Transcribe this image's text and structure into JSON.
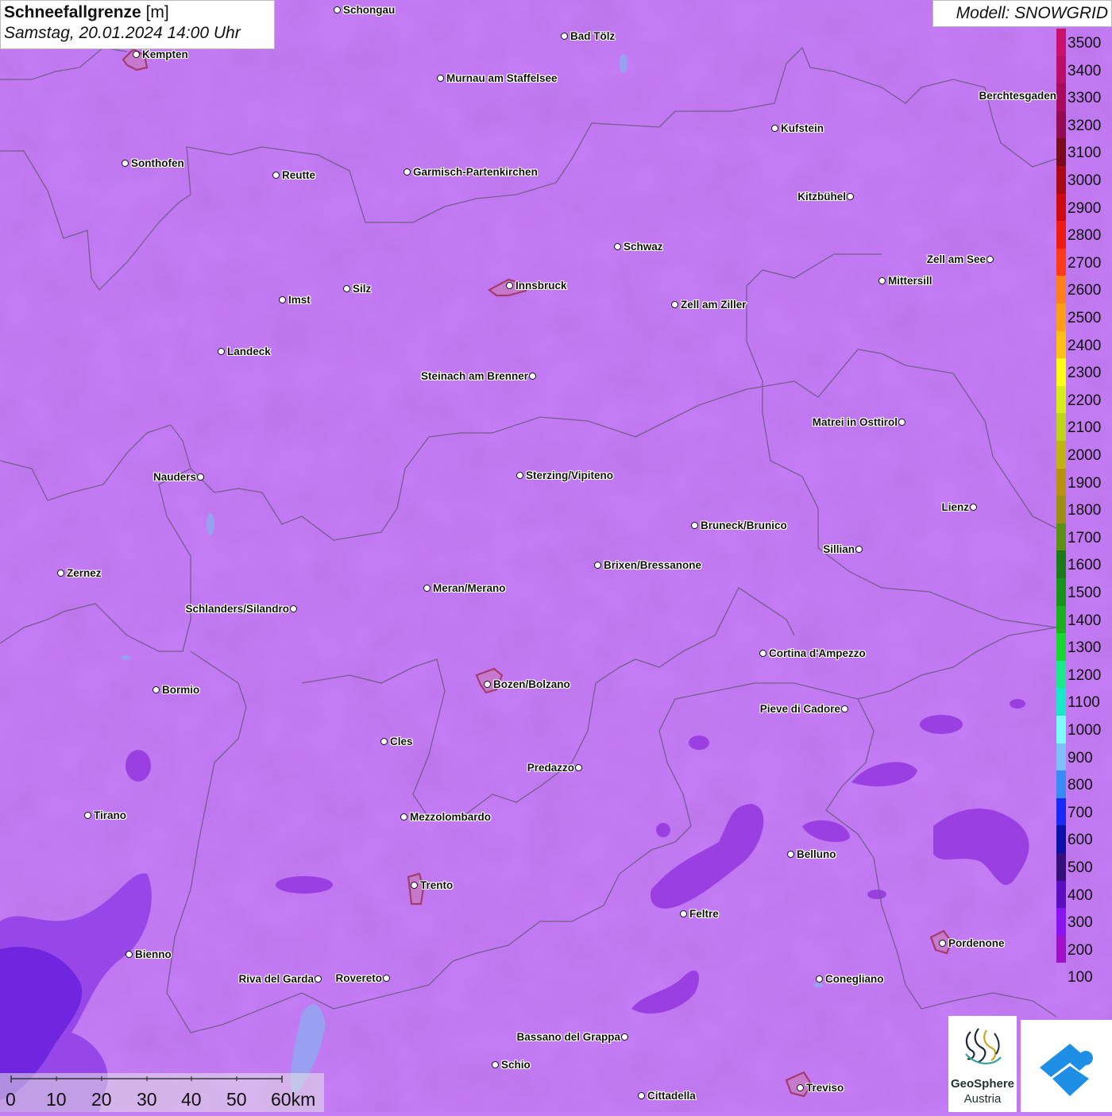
{
  "title": {
    "main": "Schneefallgrenze",
    "unit": "[m]",
    "datetime": "Samstag, 20.01.2024 14:00 Uhr"
  },
  "model": "Modell: SNOWGRID",
  "legend": {
    "items": [
      {
        "label": "3500",
        "color": "#c8116f"
      },
      {
        "label": "3400",
        "color": "#b80d68"
      },
      {
        "label": "3300",
        "color": "#a80a60"
      },
      {
        "label": "3200",
        "color": "#930a55"
      },
      {
        "label": "3100",
        "color": "#7a0a1c"
      },
      {
        "label": "3000",
        "color": "#a90a16"
      },
      {
        "label": "2900",
        "color": "#cc0b12"
      },
      {
        "label": "2800",
        "color": "#ee1b14"
      },
      {
        "label": "2700",
        "color": "#ff3a1a"
      },
      {
        "label": "2600",
        "color": "#ff7f1a"
      },
      {
        "label": "2500",
        "color": "#ff9d17"
      },
      {
        "label": "2400",
        "color": "#ffbf17"
      },
      {
        "label": "2300",
        "color": "#ffff17"
      },
      {
        "label": "2200",
        "color": "#d4ee1c"
      },
      {
        "label": "2100",
        "color": "#bcd51c"
      },
      {
        "label": "2000",
        "color": "#c1b312"
      },
      {
        "label": "1900",
        "color": "#b8920e"
      },
      {
        "label": "1800",
        "color": "#999014"
      },
      {
        "label": "1700",
        "color": "#5a9016"
      },
      {
        "label": "1600",
        "color": "#1a7a1a"
      },
      {
        "label": "1500",
        "color": "#16941a"
      },
      {
        "label": "1400",
        "color": "#1ab01e"
      },
      {
        "label": "1300",
        "color": "#1ad832"
      },
      {
        "label": "1200",
        "color": "#1be98c"
      },
      {
        "label": "1100",
        "color": "#16e8c8"
      },
      {
        "label": "1000",
        "color": "#7efcfc"
      },
      {
        "label": "900",
        "color": "#7ec0f5"
      },
      {
        "label": "800",
        "color": "#3a8af5"
      },
      {
        "label": "700",
        "color": "#1a28f5"
      },
      {
        "label": "600",
        "color": "#0a10a8"
      },
      {
        "label": "500",
        "color": "#35107a"
      },
      {
        "label": "400",
        "color": "#5a0ec0"
      },
      {
        "label": "300",
        "color": "#8a14f0"
      },
      {
        "label": "200",
        "color": "#a010c8"
      },
      {
        "label": "100",
        "color": "#c47cf5"
      }
    ]
  },
  "cities": [
    {
      "name": "Schongau",
      "dot": "left"
    },
    {
      "name": "Bad Tölz",
      "dot": "left"
    },
    {
      "name": "Kempten",
      "dot": "left"
    },
    {
      "name": "Murnau am Staffelsee",
      "dot": "left"
    },
    {
      "name": "Berchtesgaden",
      "dot": "none"
    },
    {
      "name": "Kufstein",
      "dot": "left"
    },
    {
      "name": "Sonthofen",
      "dot": "left"
    },
    {
      "name": "Reutte",
      "dot": "left"
    },
    {
      "name": "Garmisch-Partenkirchen",
      "dot": "left"
    },
    {
      "name": "Kitzbühel",
      "dot": "right"
    },
    {
      "name": "Schwaz",
      "dot": "left"
    },
    {
      "name": "Zell am See",
      "dot": "right"
    },
    {
      "name": "Mittersill",
      "dot": "left"
    },
    {
      "name": "Innsbruck",
      "dot": "left"
    },
    {
      "name": "Imst",
      "dot": "left"
    },
    {
      "name": "Silz",
      "dot": "left"
    },
    {
      "name": "Zell am Ziller",
      "dot": "left"
    },
    {
      "name": "Landeck",
      "dot": "left"
    },
    {
      "name": "Steinach am Brenner",
      "dot": "right"
    },
    {
      "name": "Matrei in Osttirol",
      "dot": "right"
    },
    {
      "name": "Nauders",
      "dot": "right"
    },
    {
      "name": "Sterzing/Vipiteno",
      "dot": "left"
    },
    {
      "name": "Lienz",
      "dot": "right"
    },
    {
      "name": "Bruneck/Brunico",
      "dot": "left"
    },
    {
      "name": "Sillian",
      "dot": "right"
    },
    {
      "name": "Zernez",
      "dot": "left"
    },
    {
      "name": "Brixen/Bressanone",
      "dot": "left"
    },
    {
      "name": "Meran/Merano",
      "dot": "left"
    },
    {
      "name": "Schlanders/Silandro",
      "dot": "right"
    },
    {
      "name": "Cortina d'Ampezzo",
      "dot": "left"
    },
    {
      "name": "Bozen/Bolzano",
      "dot": "left"
    },
    {
      "name": "Bormio",
      "dot": "left"
    },
    {
      "name": "Pieve di Cadore",
      "dot": "right"
    },
    {
      "name": "Cles",
      "dot": "left"
    },
    {
      "name": "Predazzo",
      "dot": "right"
    },
    {
      "name": "Tirano",
      "dot": "left"
    },
    {
      "name": "Mezzolombardo",
      "dot": "left"
    },
    {
      "name": "Belluno",
      "dot": "left"
    },
    {
      "name": "Trento",
      "dot": "left"
    },
    {
      "name": "Feltre",
      "dot": "left"
    },
    {
      "name": "Bienno",
      "dot": "left"
    },
    {
      "name": "Pordenone",
      "dot": "left"
    },
    {
      "name": "Riva del Garda",
      "dot": "right"
    },
    {
      "name": "Rovereto",
      "dot": "right"
    },
    {
      "name": "Conegliano",
      "dot": "left"
    },
    {
      "name": "Bassano del Grappa",
      "dot": "right"
    },
    {
      "name": "Schio",
      "dot": "left"
    },
    {
      "name": "Treviso",
      "dot": "left"
    },
    {
      "name": "Cittadella",
      "dot": "left"
    }
  ],
  "scale_bar": {
    "labels": [
      "0",
      "10",
      "20",
      "30",
      "40",
      "50",
      "60km"
    ]
  },
  "logos": {
    "geosphere_line1": "GeoSphere",
    "geosphere_line2": "Austria"
  }
}
